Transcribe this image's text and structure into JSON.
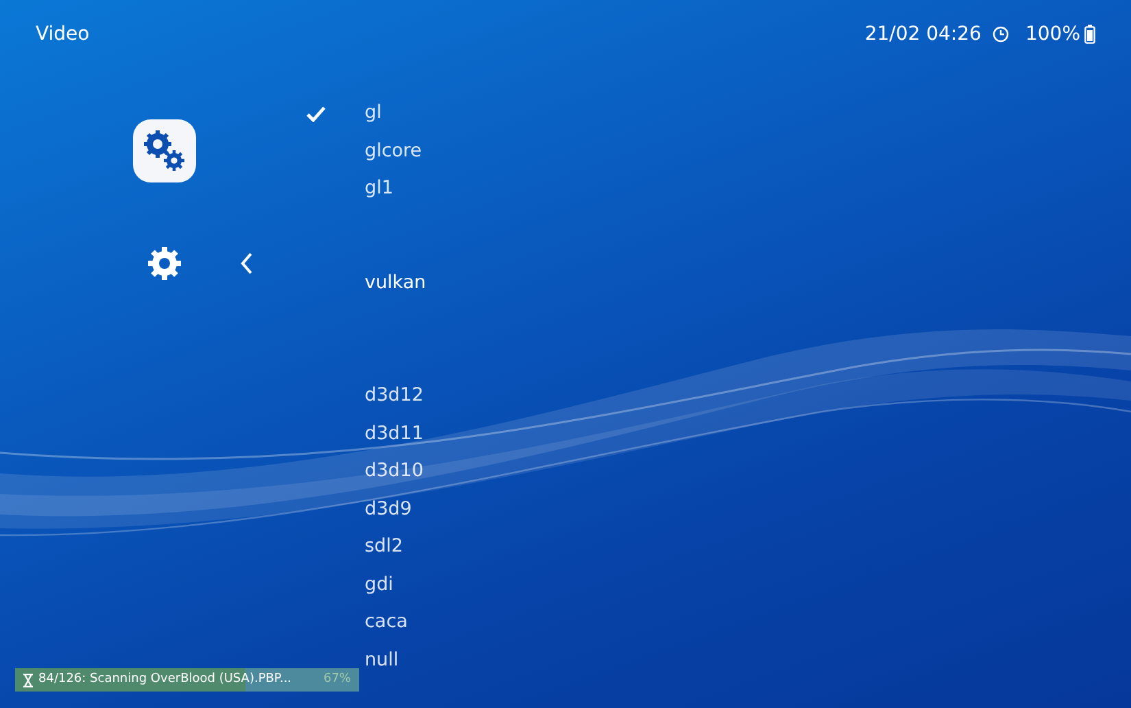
{
  "header": {
    "title": "Video",
    "datetime": "21/02 04:26",
    "battery": "100%"
  },
  "menu": {
    "items": [
      {
        "label": "gl",
        "checked": true,
        "selected": false
      },
      {
        "label": "glcore",
        "checked": false,
        "selected": false
      },
      {
        "label": "gl1",
        "checked": false,
        "selected": false
      },
      {
        "label": "vulkan",
        "checked": false,
        "selected": true
      },
      {
        "label": "d3d12",
        "checked": false,
        "selected": false
      },
      {
        "label": "d3d11",
        "checked": false,
        "selected": false
      },
      {
        "label": "d3d10",
        "checked": false,
        "selected": false
      },
      {
        "label": "d3d9",
        "checked": false,
        "selected": false
      },
      {
        "label": "sdl2",
        "checked": false,
        "selected": false
      },
      {
        "label": "gdi",
        "checked": false,
        "selected": false
      },
      {
        "label": "caca",
        "checked": false,
        "selected": false
      },
      {
        "label": "null",
        "checked": false,
        "selected": false
      }
    ]
  },
  "notification": {
    "text": "84/126: Scanning OverBlood (USA).PBP...",
    "percent": "67%",
    "level": 0.67
  }
}
